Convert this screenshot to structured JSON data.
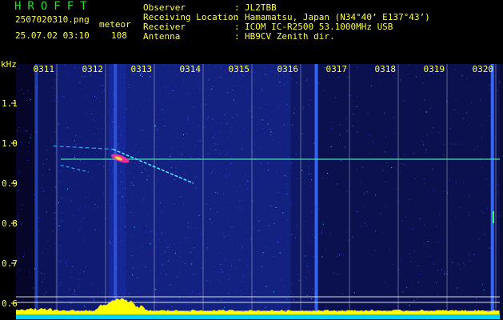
{
  "app": {
    "title": "HROFFT"
  },
  "capture": {
    "filename": "2507020310.png",
    "mode": "meteor",
    "timestamp": "25.07.02 03:10",
    "count": "108"
  },
  "station": {
    "fields": [
      {
        "label": "Observer",
        "value": "JL2TBB"
      },
      {
        "label": "Receiving Location",
        "value": "Hamamatsu, Japan (N34°40’ E137°43’)"
      },
      {
        "label": "Receiver",
        "value": "ICOM IC-R2500 53.1000MHz USB"
      },
      {
        "label": "Antenna",
        "value": "HB9CV Zenith dir."
      }
    ]
  },
  "chart_data": {
    "type": "heatmap",
    "ylabel": "kHz",
    "x_tick_labels": [
      "0311",
      "0312",
      "0313",
      "0314",
      "0315",
      "0316",
      "0317",
      "0318",
      "0319",
      "0320"
    ],
    "y_tick_labels": [
      "1.1",
      "1.0",
      "0.9",
      "0.8",
      "0.7",
      "0.6"
    ],
    "yticks": [
      1.1,
      1.0,
      0.9,
      0.8,
      0.7,
      0.6
    ],
    "ylim": [
      0.59,
      1.2
    ],
    "xlim_minutes": [
      0,
      9.15
    ],
    "carrier_khz": 0.96,
    "meteor_echo": {
      "start_minute": 1.15,
      "end_minute": 2.8,
      "freq_start_khz": 0.985,
      "freq_end_khz": 0.9
    },
    "colors": {
      "background": "#06062a",
      "noise": "#1a2fb0",
      "carrier": "#40e0b0",
      "grid": "#ffffff",
      "text": "#ffff40",
      "title": "#20e020",
      "power_trace": "#ffff00",
      "baseline": "#00d0ff"
    }
  }
}
